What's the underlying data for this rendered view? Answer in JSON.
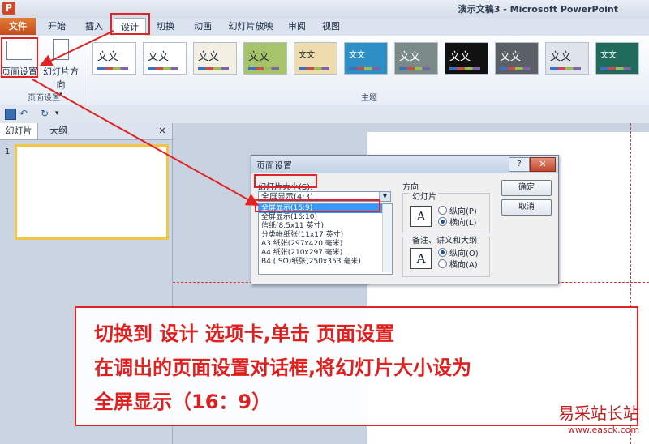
{
  "window": {
    "app_icon": "P",
    "title": "演示文稿3 - Microsoft PowerPoint"
  },
  "tabs": [
    "文件",
    "开始",
    "插入",
    "设计",
    "切换",
    "动画",
    "幻灯片放映",
    "审阅",
    "视图"
  ],
  "ribbon": {
    "page_setup_btn": "页面设置",
    "orientation_btn": "幻灯片方向",
    "page_setup_group": "页面设置",
    "themes_group": "主题",
    "theme_sample_text": "文文"
  },
  "left_pane": {
    "tab_slides": "幻灯片",
    "tab_outline": "大纲",
    "close": "✕",
    "slide_number": "1"
  },
  "dialog": {
    "title": "页面设置",
    "help": "?",
    "close": "✕",
    "size_label": "幻灯片大小(S):",
    "size_value": "全屏显示(4:3)",
    "size_options": [
      "全屏显示(16:9)",
      "全屏显示(16:10)",
      "信纸(8.5x11 英寸)",
      "分类帐纸张(11x17 英寸)",
      "A3 纸张(297x420 毫米)",
      "A4 纸张(210x297 毫米)",
      "B4 (ISO)纸张(250x353 毫米)"
    ],
    "orientation_label": "方向",
    "slides_label": "幻灯片",
    "portrait": "纵向(P)",
    "landscape": "横向(L)",
    "notes_label": "备注、讲义和大纲",
    "notes_portrait": "纵向(O)",
    "notes_landscape": "横向(A)",
    "ok": "确定",
    "cancel": "取消"
  },
  "instructions": [
    "切换到 设计 选项卡,单击 页面设置",
    "在调出的页面设置对话框,将幻灯片大小设为",
    "全屏显示（16：9）"
  ],
  "watermark": {
    "site": "易采站长站",
    "url": "www.easck.com"
  },
  "colors": {
    "accent_red": "#e02424",
    "file_tab": "#c54b1b",
    "selection": "#3399ff"
  }
}
